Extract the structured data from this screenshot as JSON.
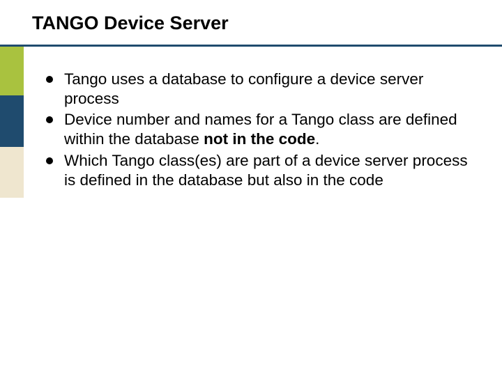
{
  "title": "TANGO Device Server",
  "bullets": [
    {
      "pre": "Tango uses a database to configure a device server process",
      "bold": "",
      "post": ""
    },
    {
      "pre": "Device number and names for a Tango class are defined within the database ",
      "bold": "not in the code",
      "post": "."
    },
    {
      "pre": "Which Tango class(es) are part of a device server process is defined in the database but also in the code",
      "bold": "",
      "post": ""
    }
  ],
  "accent_colors": {
    "green": "#a9c23f",
    "dark": "#1f4b6e",
    "tan": "#efe6cf"
  }
}
